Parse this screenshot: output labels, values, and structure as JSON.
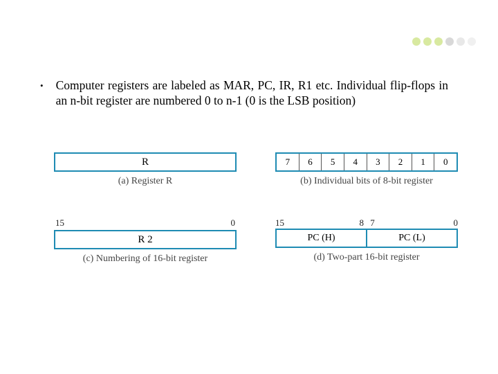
{
  "decor_colors": [
    "#d8e9a0",
    "#d8e9a0",
    "#d8e9a0",
    "#d8d8d8",
    "#e8e8e8",
    "#f0f0f0"
  ],
  "bullet": {
    "mark": "•",
    "text": "Computer registers are labeled as MAR, PC, IR, R1 etc. Individual flip-flops in an n-bit register are numbered 0 to n-1 (0 is the LSB position)"
  },
  "fig": {
    "a": {
      "label": "R",
      "caption": "(a) Register R"
    },
    "b": {
      "bits": [
        "7",
        "6",
        "5",
        "4",
        "3",
        "2",
        "1",
        "0"
      ],
      "caption": "(b) Individual bits of 8-bit register"
    },
    "c": {
      "left_num": "15",
      "right_num": "0",
      "label": "R 2",
      "caption": "(c) Numbering of 16-bit register"
    },
    "d": {
      "outer_left": "15",
      "inner_left": "8",
      "inner_right": "7",
      "outer_right": "0",
      "pch": "PC (H)",
      "pcl": "PC (L)",
      "caption": "(d) Two-part 16-bit register"
    }
  }
}
